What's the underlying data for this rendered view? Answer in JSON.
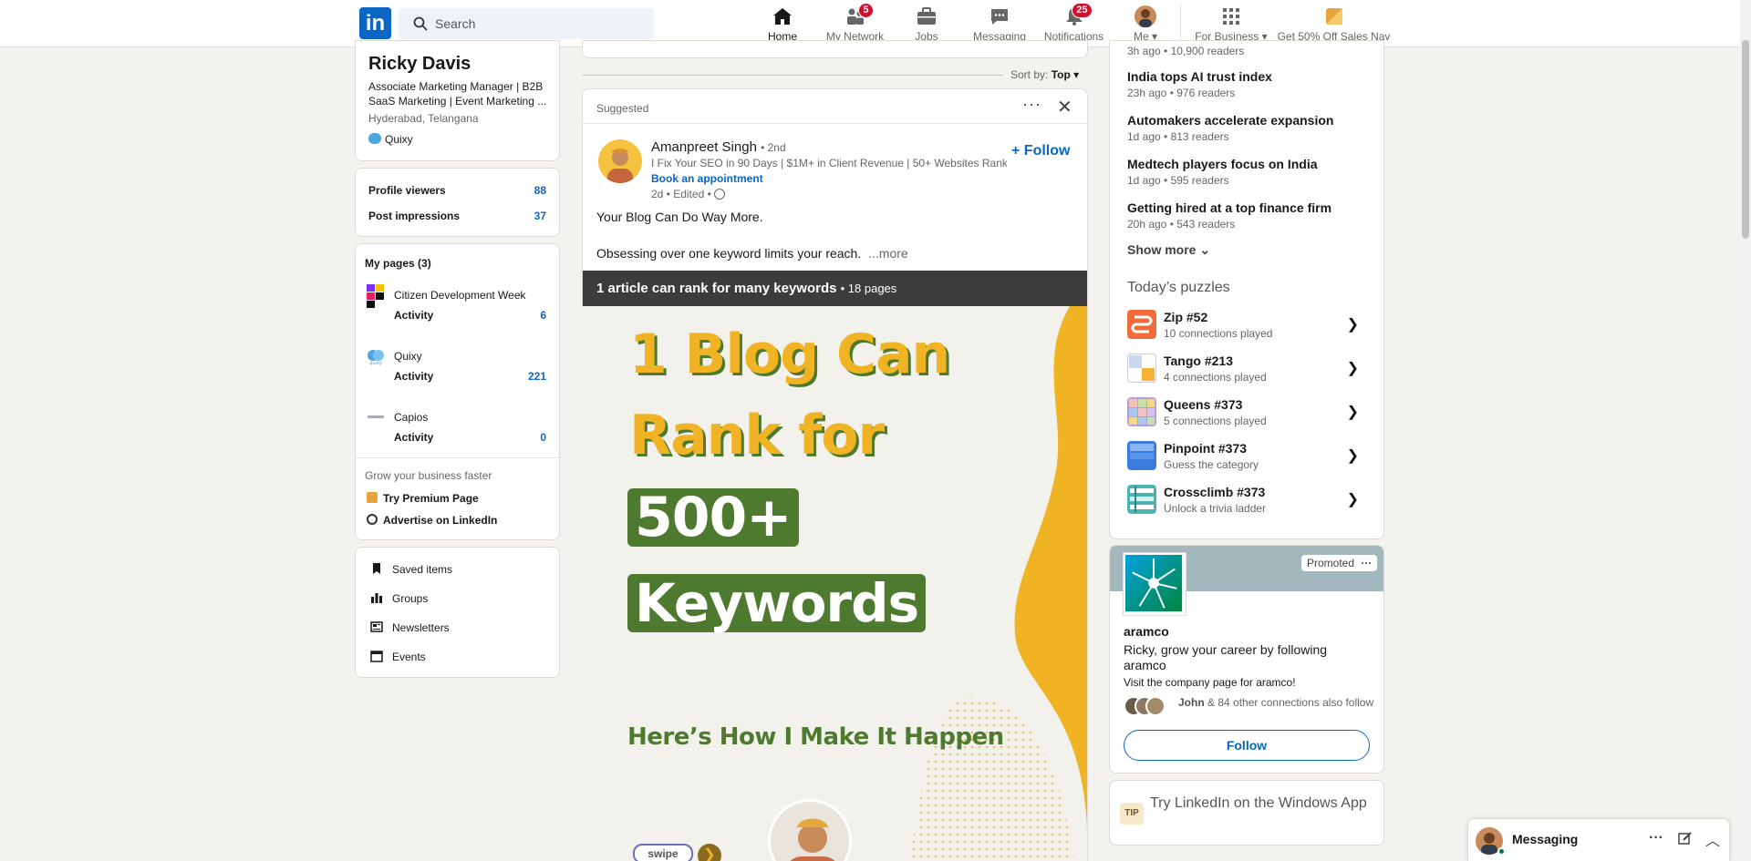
{
  "header": {
    "logo": "in",
    "search_placeholder": "Search",
    "nav": [
      {
        "label": "Home",
        "icon": "home-icon",
        "badge": ""
      },
      {
        "label": "My Network",
        "icon": "people-icon",
        "badge": "5"
      },
      {
        "label": "Jobs",
        "icon": "briefcase-icon",
        "badge": ""
      },
      {
        "label": "Messaging",
        "icon": "chat-icon",
        "badge": ""
      },
      {
        "label": "Notifications",
        "icon": "bell-icon",
        "badge": "25"
      },
      {
        "label": "Me",
        "icon": "avatar-icon",
        "badge": ""
      },
      {
        "label": "For Business",
        "icon": "grid-icon",
        "badge": ""
      },
      {
        "label": "Get 50% Off Sales Nav",
        "icon": "premium-icon",
        "badge": ""
      }
    ]
  },
  "profile": {
    "name": "Ricky Davis",
    "headline": "Associate Marketing Manager | B2B SaaS Marketing | Event Marketing ...",
    "location": "Hyderabad, Telangana",
    "company": "Quixy"
  },
  "stats": [
    {
      "label": "Profile viewers",
      "value": "88"
    },
    {
      "label": "Post impressions",
      "value": "37"
    }
  ],
  "my_pages": {
    "title": "My pages (3)",
    "pages": [
      {
        "name": "Citizen Development Week",
        "activity_label": "Activity",
        "activity": "6"
      },
      {
        "name": "Quixy",
        "activity_label": "Activity",
        "activity": "221"
      },
      {
        "name": "Capios",
        "activity_label": "Activity",
        "activity": "0"
      }
    ],
    "grow_label": "Grow your business faster",
    "premium_page": "Try Premium Page",
    "advertise": "Advertise on LinkedIn"
  },
  "shortcuts": [
    "Saved items",
    "Groups",
    "Newsletters",
    "Events"
  ],
  "feed": {
    "sort_label": "Sort by:",
    "sort_value": "Top",
    "suggested": "Suggested",
    "author": "Amanpreet Singh",
    "degree": "• 2nd",
    "author_headline": "I Fix Your SEO in 90 Days | $1M+ in Client Revenue | 50+ Websites Rank...",
    "book": "Book an appointment",
    "time": "2d • Edited •",
    "follow": "Follow",
    "line1": "Your Blog Can Do Way More.",
    "line2": "Obsessing over one keyword limits your reach.",
    "more": "...more",
    "doc_title": "1 article can rank for many keywords",
    "doc_pages": "• 18 pages",
    "slide": {
      "l1": "1 Blog Can",
      "l2": "Rank for",
      "l3": "500+",
      "l4": "Keywords",
      "l5": "Here’s How I Make It Happen",
      "swipe": "swipe"
    }
  },
  "news": {
    "top_sub": "3h ago • 10,900 readers",
    "items": [
      {
        "title": "India tops AI trust index",
        "sub": "23h ago • 976 readers"
      },
      {
        "title": "Automakers accelerate expansion",
        "sub": "1d ago • 813 readers"
      },
      {
        "title": "Medtech players focus on India",
        "sub": "1d ago • 595 readers"
      },
      {
        "title": "Getting hired at a top finance firm",
        "sub": "20h ago • 543 readers"
      }
    ],
    "show_more": "Show more"
  },
  "puzzles": {
    "title": "Today’s puzzles",
    "items": [
      {
        "name": "Zip #52",
        "sub": "10 connections played",
        "color": "#f26b3a"
      },
      {
        "name": "Tango #213",
        "sub": "4 connections played",
        "color": "#f5b335"
      },
      {
        "name": "Queens #373",
        "sub": "5 connections played",
        "color": "#b59fd6"
      },
      {
        "name": "Pinpoint #373",
        "sub": "Guess the category",
        "color": "#3a7be0"
      },
      {
        "name": "Crossclimb #373",
        "sub": "Unlock a trivia ladder",
        "color": "#4bb4b0"
      }
    ]
  },
  "ad": {
    "promoted": "Promoted",
    "company": "aramco",
    "headline": "Ricky, grow your career by following aramco",
    "body": "Visit the company page for aramco!",
    "connections_name": "John",
    "connections_rest": "& 84 other connections also follow",
    "follow": "Follow"
  },
  "tip": {
    "badge": "TIP",
    "text": "Try LinkedIn on the Windows App"
  },
  "messaging": {
    "label": "Messaging"
  },
  "colors": {
    "brand": "#0a66c2",
    "badge": "#cb112d",
    "slide_green": "#4e7a2f",
    "slide_yellow": "#f0b323"
  }
}
